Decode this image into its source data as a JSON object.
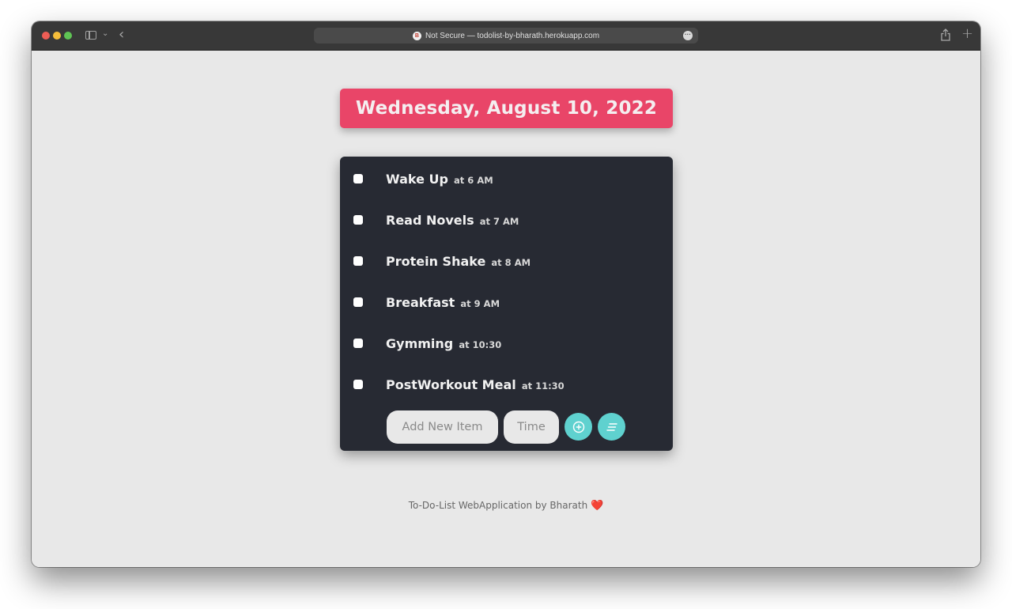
{
  "browser": {
    "url_text": "Not Secure — todolist-by-bharath.herokuapp.com",
    "security_icon": "brave-lion-icon",
    "more_icon": "ellipsis-circle-icon",
    "buttons": {
      "close": "close-window",
      "minimize": "minimize-window",
      "zoom": "zoom-window",
      "sidebar": "sidebar-icon",
      "tab_group_menu": "chevron-down-icon",
      "back": "chevron-left-icon",
      "share": "share-icon",
      "new_tab": "plus-icon"
    }
  },
  "page": {
    "date_heading": "Wednesday, August 10, 2022",
    "items": [
      {
        "name": "Wake Up",
        "time": "at 6 AM",
        "checked": false
      },
      {
        "name": "Read Novels",
        "time": "at 7 AM",
        "checked": false
      },
      {
        "name": "Protein Shake",
        "time": "at 8 AM",
        "checked": false
      },
      {
        "name": "Breakfast",
        "time": "at 9 AM",
        "checked": false
      },
      {
        "name": "Gymming",
        "time": "at 10:30",
        "checked": false
      },
      {
        "name": "PostWorkout Meal",
        "time": "at 11:30",
        "checked": false
      }
    ],
    "new_item_placeholder": "Add New Item",
    "time_placeholder": "Time",
    "add_button_icon": "plus-circle-icon",
    "sort_button_icon": "sort-lines-icon",
    "footer_text": "To-Do-List WebApplication by Bharath",
    "footer_emoji": "❤️"
  },
  "colors": {
    "banner": "#e94568",
    "card": "#272a33",
    "accent_button": "#5fd1cf",
    "page_bg": "#e8e8e8"
  }
}
